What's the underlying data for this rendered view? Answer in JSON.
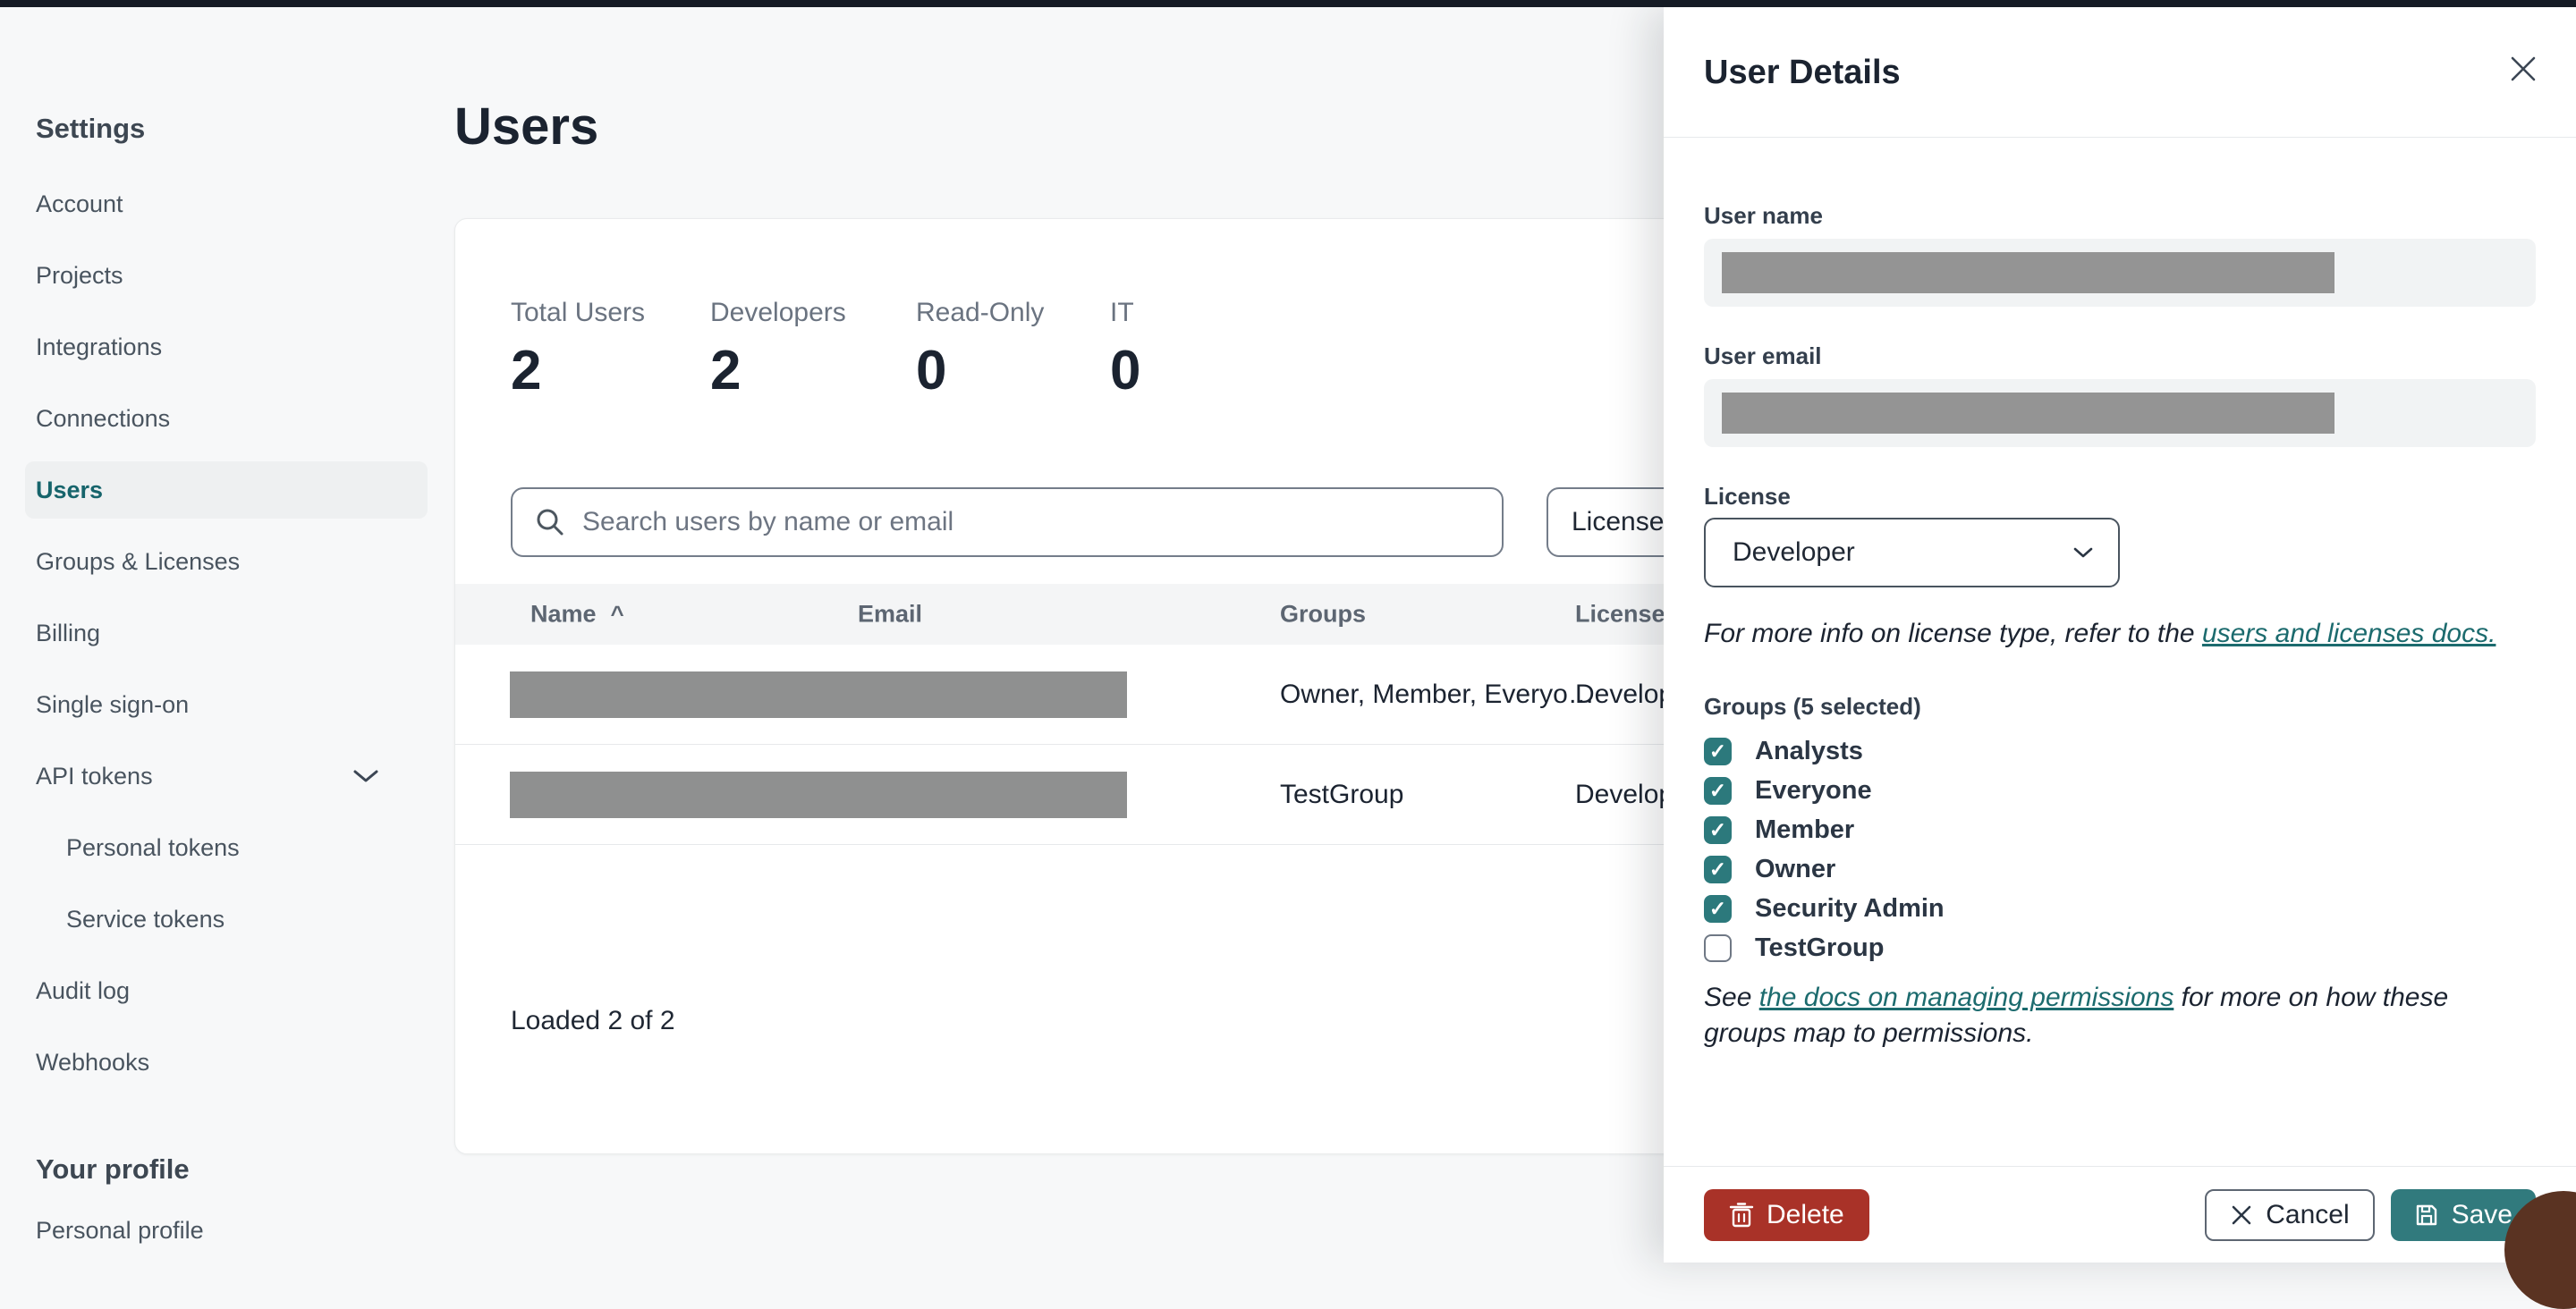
{
  "sidebar": {
    "settings_heading": "Settings",
    "items": [
      {
        "label": "Account"
      },
      {
        "label": "Projects"
      },
      {
        "label": "Integrations"
      },
      {
        "label": "Connections"
      },
      {
        "label": "Users",
        "active": true
      },
      {
        "label": "Groups & Licenses"
      },
      {
        "label": "Billing"
      },
      {
        "label": "Single sign-on"
      },
      {
        "label": "API tokens",
        "has_chevron": true
      },
      {
        "label": "Personal tokens",
        "child": true
      },
      {
        "label": "Service tokens",
        "child": true
      },
      {
        "label": "Audit log"
      },
      {
        "label": "Webhooks"
      }
    ],
    "profile_heading": "Your profile",
    "profile_items": [
      {
        "label": "Personal profile"
      }
    ]
  },
  "main": {
    "title": "Users",
    "stats": [
      {
        "label": "Total Users",
        "value": "2"
      },
      {
        "label": "Developers",
        "value": "2"
      },
      {
        "label": "Read-Only",
        "value": "0"
      },
      {
        "label": "IT",
        "value": "0"
      }
    ],
    "search": {
      "placeholder": "Search users by name or email",
      "value": ""
    },
    "license_filter_label": "License",
    "table": {
      "columns": [
        "Name",
        "Email",
        "Groups",
        "License"
      ],
      "sort_indicator": "^",
      "rows": [
        {
          "name_redacted": true,
          "groups": "Owner, Member, Everyo…",
          "license": "Developer"
        },
        {
          "name_redacted": true,
          "groups": "TestGroup",
          "license": "Developer"
        }
      ],
      "footer_status": "Loaded 2 of 2"
    }
  },
  "panel": {
    "title": "User Details",
    "close_icon": "close",
    "user_name_label": "User name",
    "user_email_label": "User email",
    "license_label": "License",
    "license_value": "Developer",
    "license_note": {
      "prefix": "For more info on license type, refer to the ",
      "link": "users and licenses docs."
    },
    "groups_label": "Groups (5 selected)",
    "groups": [
      {
        "name": "Analysts",
        "checked": true
      },
      {
        "name": "Everyone",
        "checked": true
      },
      {
        "name": "Member",
        "checked": true
      },
      {
        "name": "Owner",
        "checked": true
      },
      {
        "name": "Security Admin",
        "checked": true
      },
      {
        "name": "TestGroup",
        "checked": false
      }
    ],
    "permissions_note": {
      "prefix": "See ",
      "link": "the docs on managing permissions",
      "suffix": " for more on how these groups map to permissions."
    },
    "footer": {
      "delete_label": "Delete",
      "cancel_label": "Cancel",
      "save_label": "Save"
    }
  },
  "colors": {
    "topbar": "#151b25",
    "active_nav_text": "#16646b",
    "link_teal": "#1c6b6e",
    "checkbox_teal": "#2c797c",
    "delete_red": "#a93228",
    "save_teal": "#317a7d"
  }
}
